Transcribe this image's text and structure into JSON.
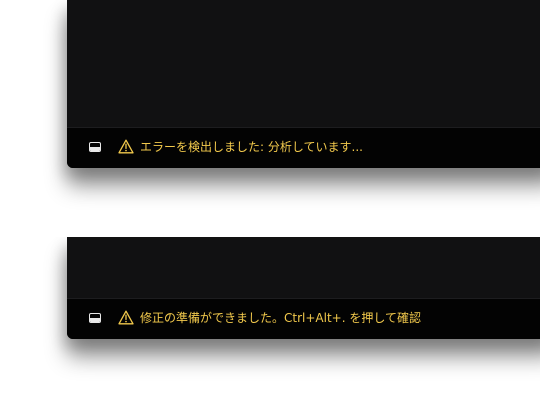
{
  "states": [
    {
      "status_message": "エラーを検出しました: 分析しています..."
    },
    {
      "status_message": "修正の準備ができました。Ctrl+Alt+. を押して確認"
    }
  ],
  "icons": {
    "panel": "panel-toggle-icon",
    "warning": "warning-icon"
  },
  "colors": {
    "background": "#111112",
    "status_bar": "#030303",
    "warning_text": "#f2c94c",
    "icon": "#e8e8e8"
  }
}
